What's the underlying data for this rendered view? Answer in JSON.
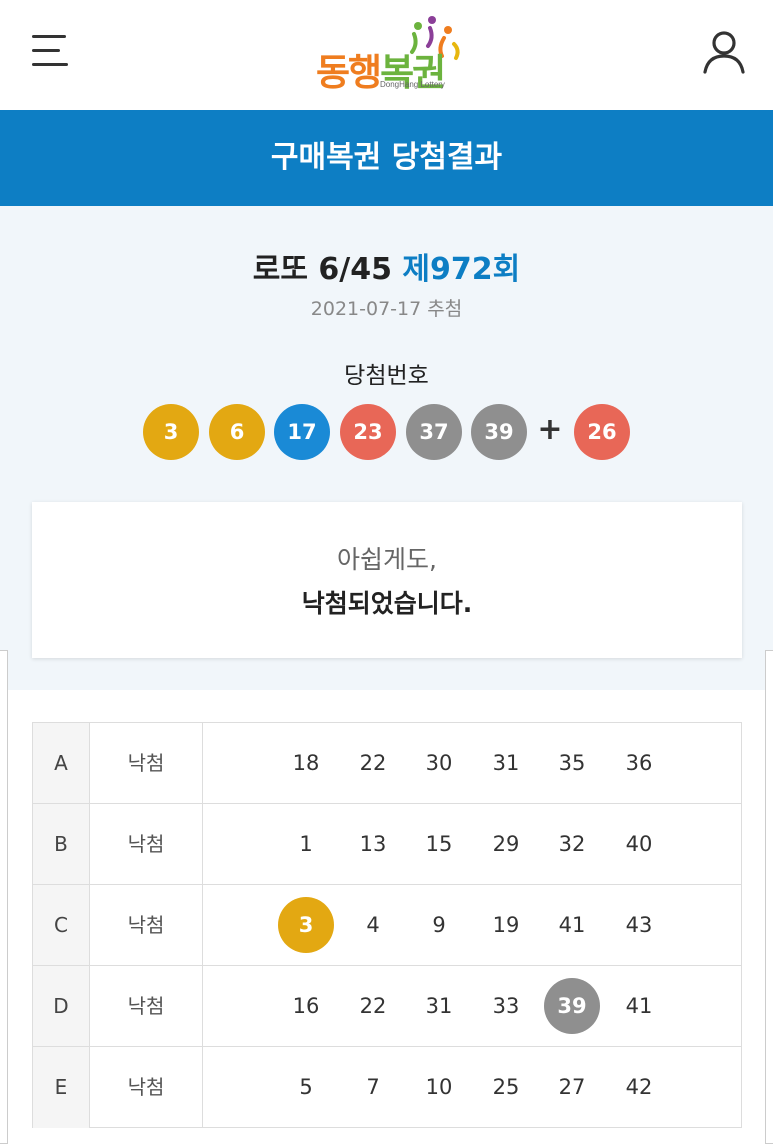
{
  "header": {
    "logo_text_1": "동행",
    "logo_text_2": "복권",
    "logo_sub": "DongHang Lottery"
  },
  "banner": {
    "title": "구매복권 당첨결과"
  },
  "draw": {
    "game_name": "로또 6/45",
    "round": "제972회",
    "date": "2021-07-17 추첨",
    "label": "당첨번호",
    "plus": "+",
    "numbers": [
      {
        "value": "3",
        "color": "#e3a812"
      },
      {
        "value": "6",
        "color": "#e3a812"
      },
      {
        "value": "17",
        "color": "#1a8ad6"
      },
      {
        "value": "23",
        "color": "#e86757"
      },
      {
        "value": "37",
        "color": "#8f8f8f"
      },
      {
        "value": "39",
        "color": "#8f8f8f"
      }
    ],
    "bonus": {
      "value": "26",
      "color": "#e86757"
    }
  },
  "result": {
    "line1": "아쉽게도,",
    "line2": "낙첨되었습니다."
  },
  "games": [
    {
      "label": "A",
      "status": "낙첨",
      "numbers": [
        "18",
        "22",
        "30",
        "31",
        "35",
        "36"
      ],
      "hits": []
    },
    {
      "label": "B",
      "status": "낙첨",
      "numbers": [
        "1",
        "13",
        "15",
        "29",
        "32",
        "40"
      ],
      "hits": []
    },
    {
      "label": "C",
      "status": "낙첨",
      "numbers": [
        "3",
        "4",
        "9",
        "19",
        "41",
        "43"
      ],
      "hits": [
        {
          "index": 0,
          "color": "#e3a812"
        }
      ]
    },
    {
      "label": "D",
      "status": "낙첨",
      "numbers": [
        "16",
        "22",
        "31",
        "33",
        "39",
        "41"
      ],
      "hits": [
        {
          "index": 4,
          "color": "#8f8f8f"
        }
      ]
    },
    {
      "label": "E",
      "status": "낙첨",
      "numbers": [
        "5",
        "7",
        "10",
        "25",
        "27",
        "42"
      ],
      "hits": []
    }
  ],
  "colors": {
    "brand_blue": "#0d7ec4",
    "logo_orange": "#ef7d1f",
    "logo_green": "#6cb33e",
    "logo_purple": "#8b3f98"
  },
  "icons": {
    "menu": "hamburger-menu-icon",
    "user": "user-profile-icon"
  }
}
